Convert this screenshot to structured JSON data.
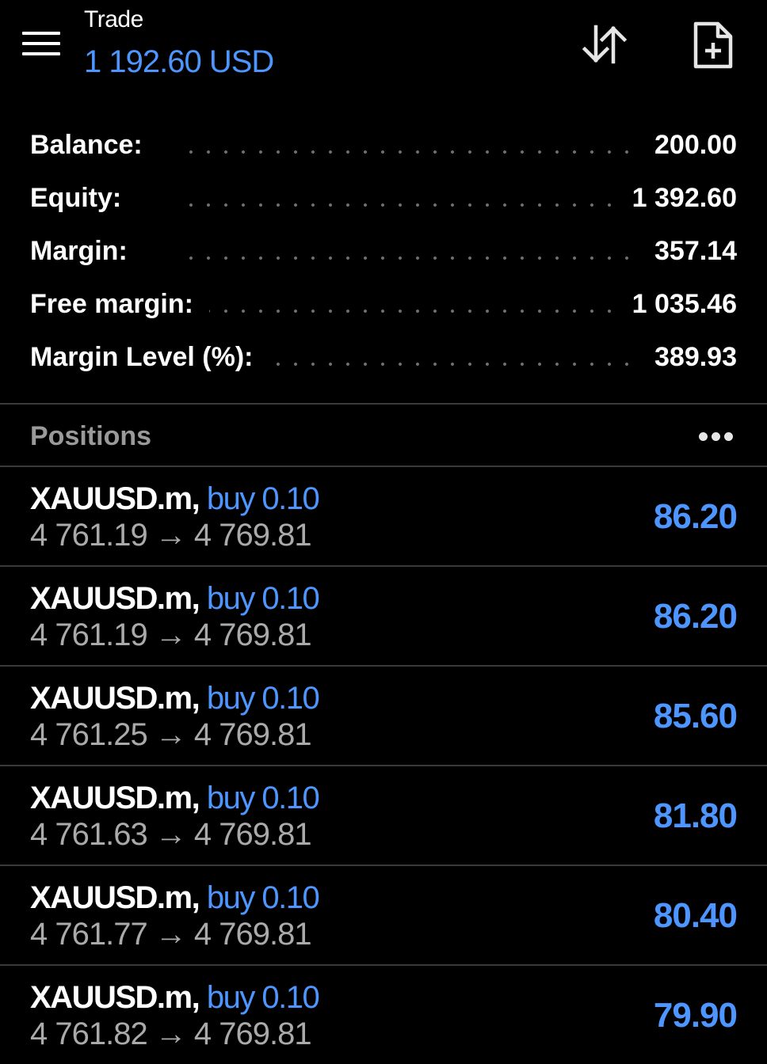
{
  "header": {
    "title": "Trade",
    "subtitle": "1 192.60 USD",
    "icons": [
      "menu-icon",
      "sort-icon",
      "new-order-icon"
    ]
  },
  "summary": [
    {
      "label": "Balance:",
      "value": "200.00"
    },
    {
      "label": "Equity:",
      "value": "1 392.60"
    },
    {
      "label": "Margin:",
      "value": "357.14"
    },
    {
      "label": "Free margin:",
      "value": "1 035.46"
    },
    {
      "label": "Margin Level (%):",
      "value": "389.93"
    }
  ],
  "positions_section": {
    "title": "Positions",
    "more_icon": "more-horizontal-icon"
  },
  "positions": [
    {
      "symbol": "XAUUSD.m,",
      "side": "buy 0.10",
      "prices": "4 761.19 → 4 769.81",
      "profit": "86.20"
    },
    {
      "symbol": "XAUUSD.m,",
      "side": "buy 0.10",
      "prices": "4 761.19 → 4 769.81",
      "profit": "86.20"
    },
    {
      "symbol": "XAUUSD.m,",
      "side": "buy 0.10",
      "prices": "4 761.25 → 4 769.81",
      "profit": "85.60"
    },
    {
      "symbol": "XAUUSD.m,",
      "side": "buy 0.10",
      "prices": "4 761.63 → 4 769.81",
      "profit": "81.80"
    },
    {
      "symbol": "XAUUSD.m,",
      "side": "buy 0.10",
      "prices": "4 761.77 → 4 769.81",
      "profit": "80.40"
    },
    {
      "symbol": "XAUUSD.m,",
      "side": "buy 0.10",
      "prices": "4 761.82 → 4 769.81",
      "profit": "79.90"
    }
  ],
  "colors": {
    "background": "#000000",
    "accent": "#4e96ff",
    "muted": "#9a9a9a",
    "divider": "#3a3a3a"
  }
}
